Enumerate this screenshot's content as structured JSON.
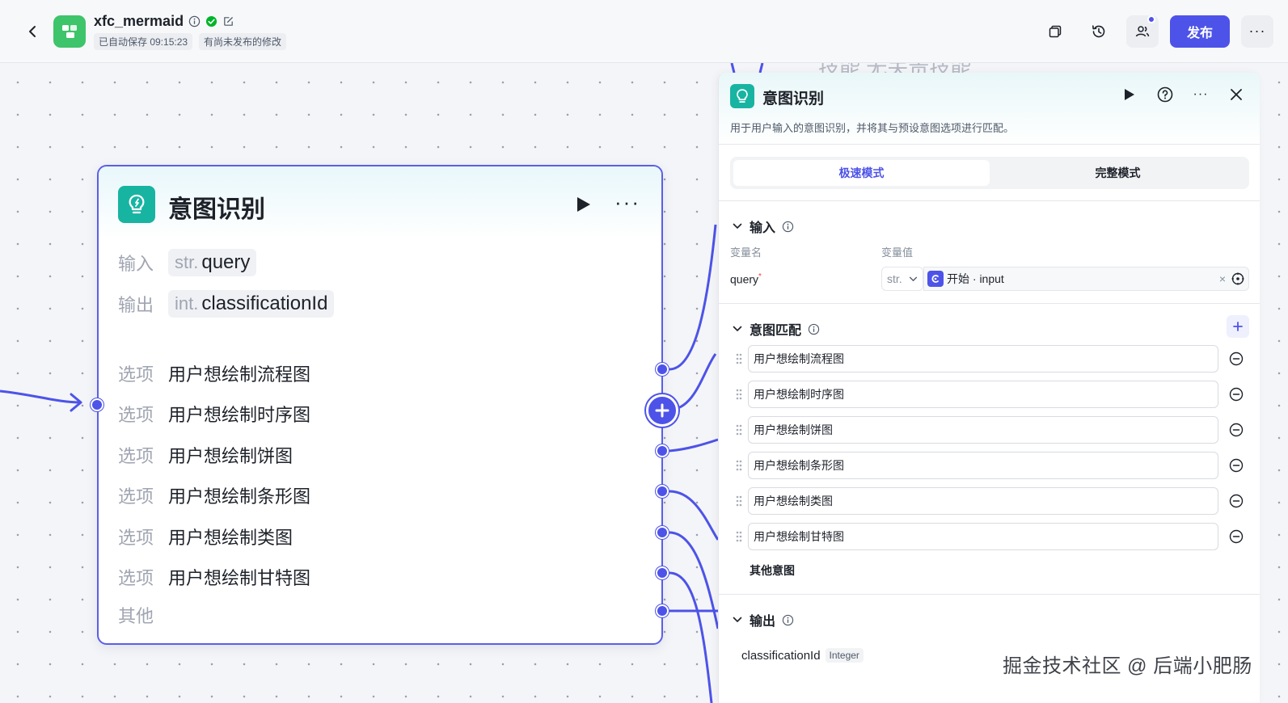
{
  "topbar": {
    "app_name": "xfc_mermaid",
    "autosave": "已自动保存 09:15:23",
    "unpublished": "有尚未发布的修改",
    "publish_label": "发布",
    "more_label": "···"
  },
  "canvas": {
    "bg_fragment": "技能 无关责技能"
  },
  "node": {
    "title": "意图识别",
    "more_label": "···",
    "input_label": "输入",
    "input_type": "str.",
    "input_name": "query",
    "output_label": "输出",
    "output_type": "int.",
    "output_name": "classificationId",
    "option_label": "选项",
    "options": [
      "用户想绘制流程图",
      "用户想绘制时序图",
      "用户想绘制饼图",
      "用户想绘制条形图",
      "用户想绘制类图",
      "用户想绘制甘特图"
    ],
    "other_label": "其他"
  },
  "panel": {
    "title": "意图识别",
    "more_label": "···",
    "description": "用于用户输入的意图识别，并将其与预设意图选项进行匹配。",
    "tabs": {
      "fast": "极速模式",
      "full": "完整模式"
    },
    "input_section": "输入",
    "col_name": "变量名",
    "col_value": "变量值",
    "var_name": "query",
    "required_mark": "*",
    "var_type": "str.",
    "var_ref": "开始 · input",
    "clear_label": "×",
    "intent_section": "意图匹配",
    "intents": [
      "用户想绘制流程图",
      "用户想绘制时序图",
      "用户想绘制饼图",
      "用户想绘制条形图",
      "用户想绘制类图",
      "用户想绘制甘特图"
    ],
    "other_intent": "其他意图",
    "output_section": "输出",
    "output_name": "classificationId",
    "output_type": "Integer"
  },
  "watermark": "掘金技术社区 @ 后端小肥肠",
  "colors": {
    "accent": "#4d53e8",
    "node_icon": "#18b4a2",
    "app_logo": "#3ec46a"
  }
}
